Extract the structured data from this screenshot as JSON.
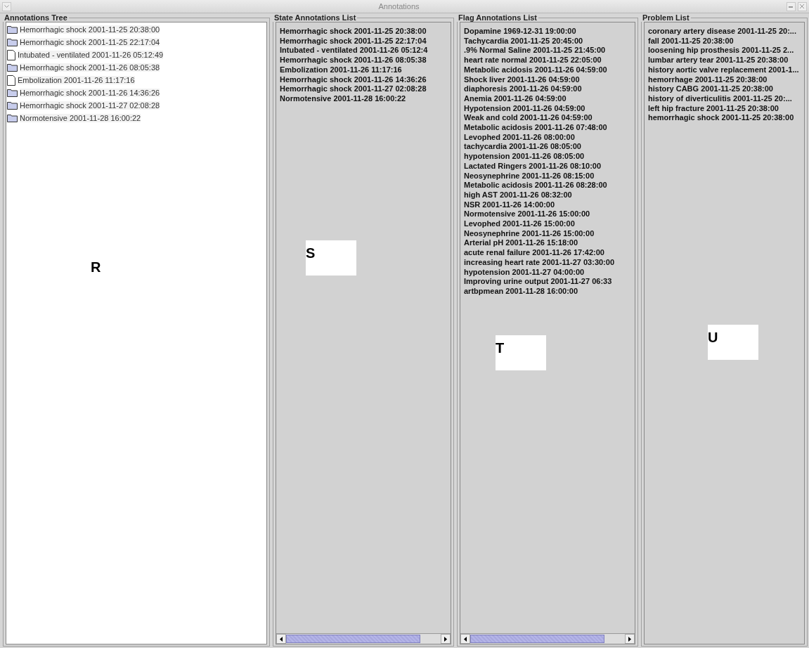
{
  "window": {
    "title": "Annotations"
  },
  "tree": {
    "title": "Annotations Tree",
    "marker": "R",
    "items": [
      {
        "label": "Hemorrhagic shock 2001-11-25 20:38:00",
        "kind": "folder"
      },
      {
        "label": "Hemorrhagic shock 2001-11-25 22:17:04",
        "kind": "folder"
      },
      {
        "label": "Intubated - ventilated 2001-11-26 05:12:49",
        "kind": "file"
      },
      {
        "label": "Hemorrhagic shock 2001-11-26 08:05:38",
        "kind": "folder"
      },
      {
        "label": "Embolization 2001-11-26 11:17:16",
        "kind": "file"
      },
      {
        "label": "Hemorrhagic shock 2001-11-26 14:36:26",
        "kind": "folder"
      },
      {
        "label": "Hemorrhagic shock 2001-11-27 02:08:28",
        "kind": "folder"
      },
      {
        "label": "Normotensive 2001-11-28 16:00:22",
        "kind": "folder"
      }
    ]
  },
  "lists": [
    {
      "title": "State Annotations List",
      "marker": "S",
      "scrollbar": true,
      "items": [
        "Hemorrhagic shock 2001-11-25 20:38:00",
        "Hemorrhagic shock 2001-11-25 22:17:04",
        "Intubated - ventilated 2001-11-26 05:12:4",
        "Hemorrhagic shock 2001-11-26 08:05:38",
        "Embolization 2001-11-26 11:17:16",
        "Hemorrhagic shock 2001-11-26 14:36:26",
        "Hemorrhagic shock 2001-11-27 02:08:28",
        "Normotensive 2001-11-28 16:00:22"
      ]
    },
    {
      "title": "Flag Annotations List",
      "marker": "T",
      "scrollbar": true,
      "items": [
        "Dopamine 1969-12-31 19:00:00",
        "Tachycardia 2001-11-25 20:45:00",
        ".9% Normal Saline 2001-11-25 21:45:00",
        "heart rate normal 2001-11-25 22:05:00",
        "Metabolic acidosis 2001-11-26 04:59:00",
        "Shock liver 2001-11-26 04:59:00",
        "diaphoresis 2001-11-26 04:59:00",
        "Anemia 2001-11-26 04:59:00",
        "Hypotension 2001-11-26 04:59:00",
        "Weak and cold 2001-11-26 04:59:00",
        "Metabolic acidosis 2001-11-26 07:48:00",
        "Levophed 2001-11-26 08:00:00",
        "tachycardia 2001-11-26 08:05:00",
        "hypotension 2001-11-26 08:05:00",
        "Lactated Ringers 2001-11-26 08:10:00",
        "Neosynephrine 2001-11-26 08:15:00",
        "Metabolic acidosis 2001-11-26 08:28:00",
        "high AST 2001-11-26 08:32:00",
        "NSR 2001-11-26 14:00:00",
        "Normotensive 2001-11-26 15:00:00",
        "Levophed 2001-11-26 15:00:00",
        "Neosynephrine 2001-11-26 15:00:00",
        "Arterial pH 2001-11-26 15:18:00",
        "acute renal failure 2001-11-26 17:42:00",
        "increasing heart rate 2001-11-27 03:30:00",
        "hypotension 2001-11-27 04:00:00",
        "Improving urine output 2001-11-27 06:33",
        "artbpmean 2001-11-28 16:00:00"
      ]
    },
    {
      "title": "Problem List",
      "marker": "U",
      "scrollbar": false,
      "items": [
        "coronary artery disease 2001-11-25 20:...",
        "fall 2001-11-25 20:38:00",
        "loosening hip prosthesis 2001-11-25 2...",
        "lumbar artery tear 2001-11-25 20:38:00",
        "history aortic valve replacement 2001-1...",
        "hemorrhage  2001-11-25 20:38:00",
        "history CABG 2001-11-25 20:38:00",
        "history of diverticulitis 2001-11-25 20:...",
        "left hip fracture 2001-11-25 20:38:00",
        "hemorrhagic shock 2001-11-25 20:38:00"
      ]
    }
  ]
}
